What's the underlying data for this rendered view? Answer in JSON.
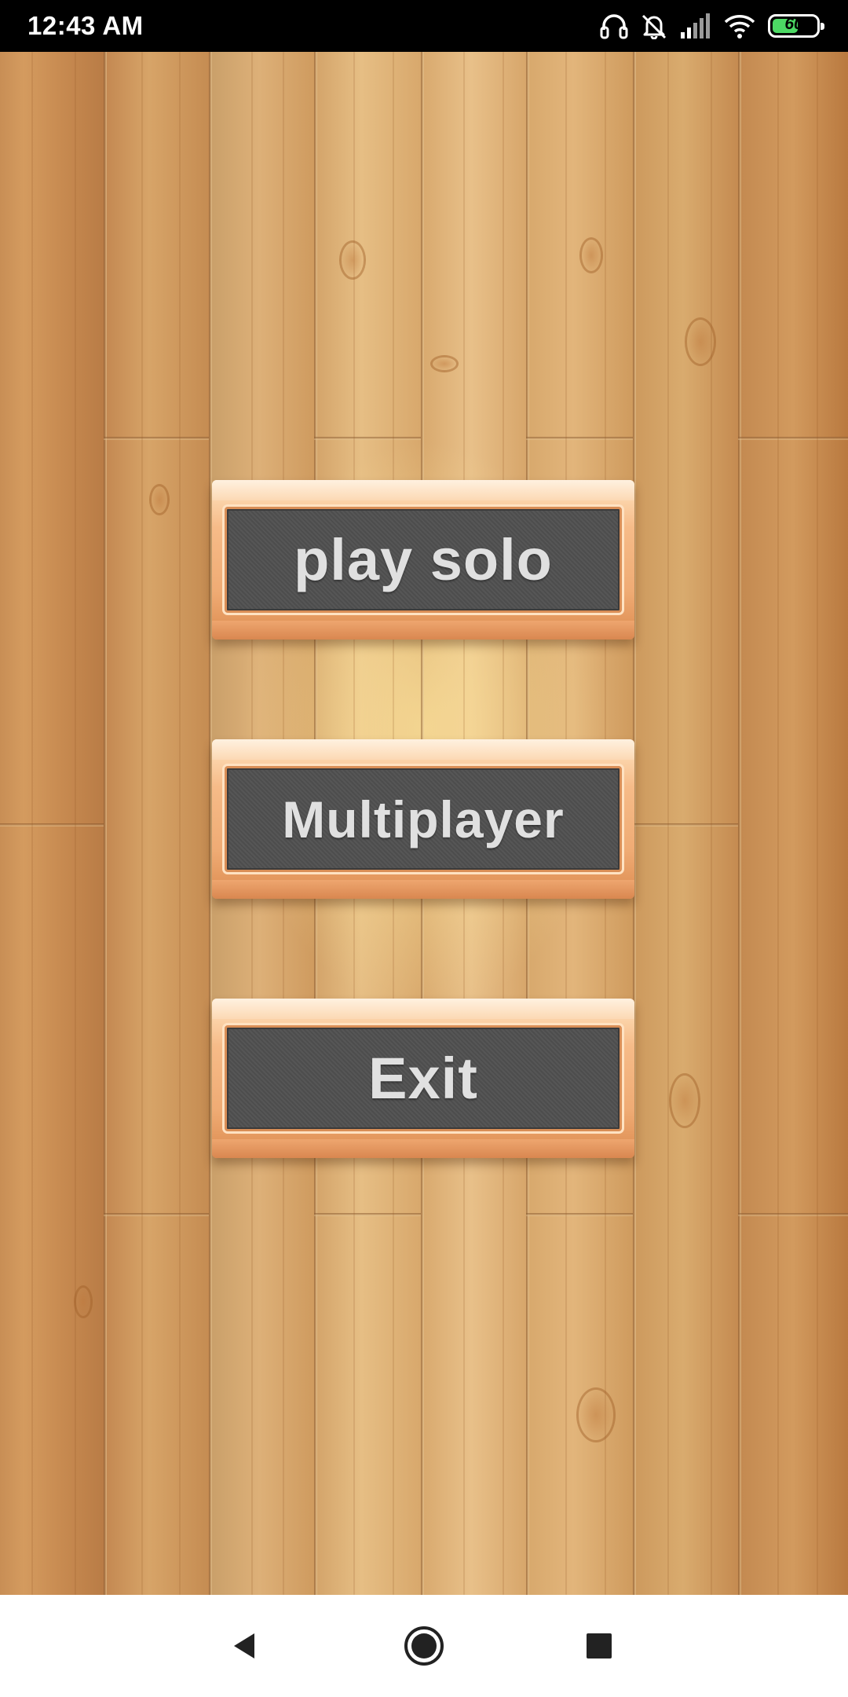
{
  "status_bar": {
    "time": "12:43 AM",
    "battery_level": "60",
    "battery_fraction": 0.6,
    "icons": [
      "headphones-icon",
      "bell-off-icon",
      "signal-icon",
      "wifi-icon",
      "battery-icon"
    ]
  },
  "menu": {
    "play_solo_label": "play solo",
    "multiplayer_label": "Multiplayer",
    "exit_label": "Exit"
  },
  "nav_bar": {
    "icons": [
      "back-icon",
      "home-icon",
      "recents-icon"
    ]
  },
  "colors": {
    "button_panel": "#505050",
    "button_frame": "#efab74",
    "button_text": "#e0e0e0",
    "battery_fill": "#4cd964"
  }
}
